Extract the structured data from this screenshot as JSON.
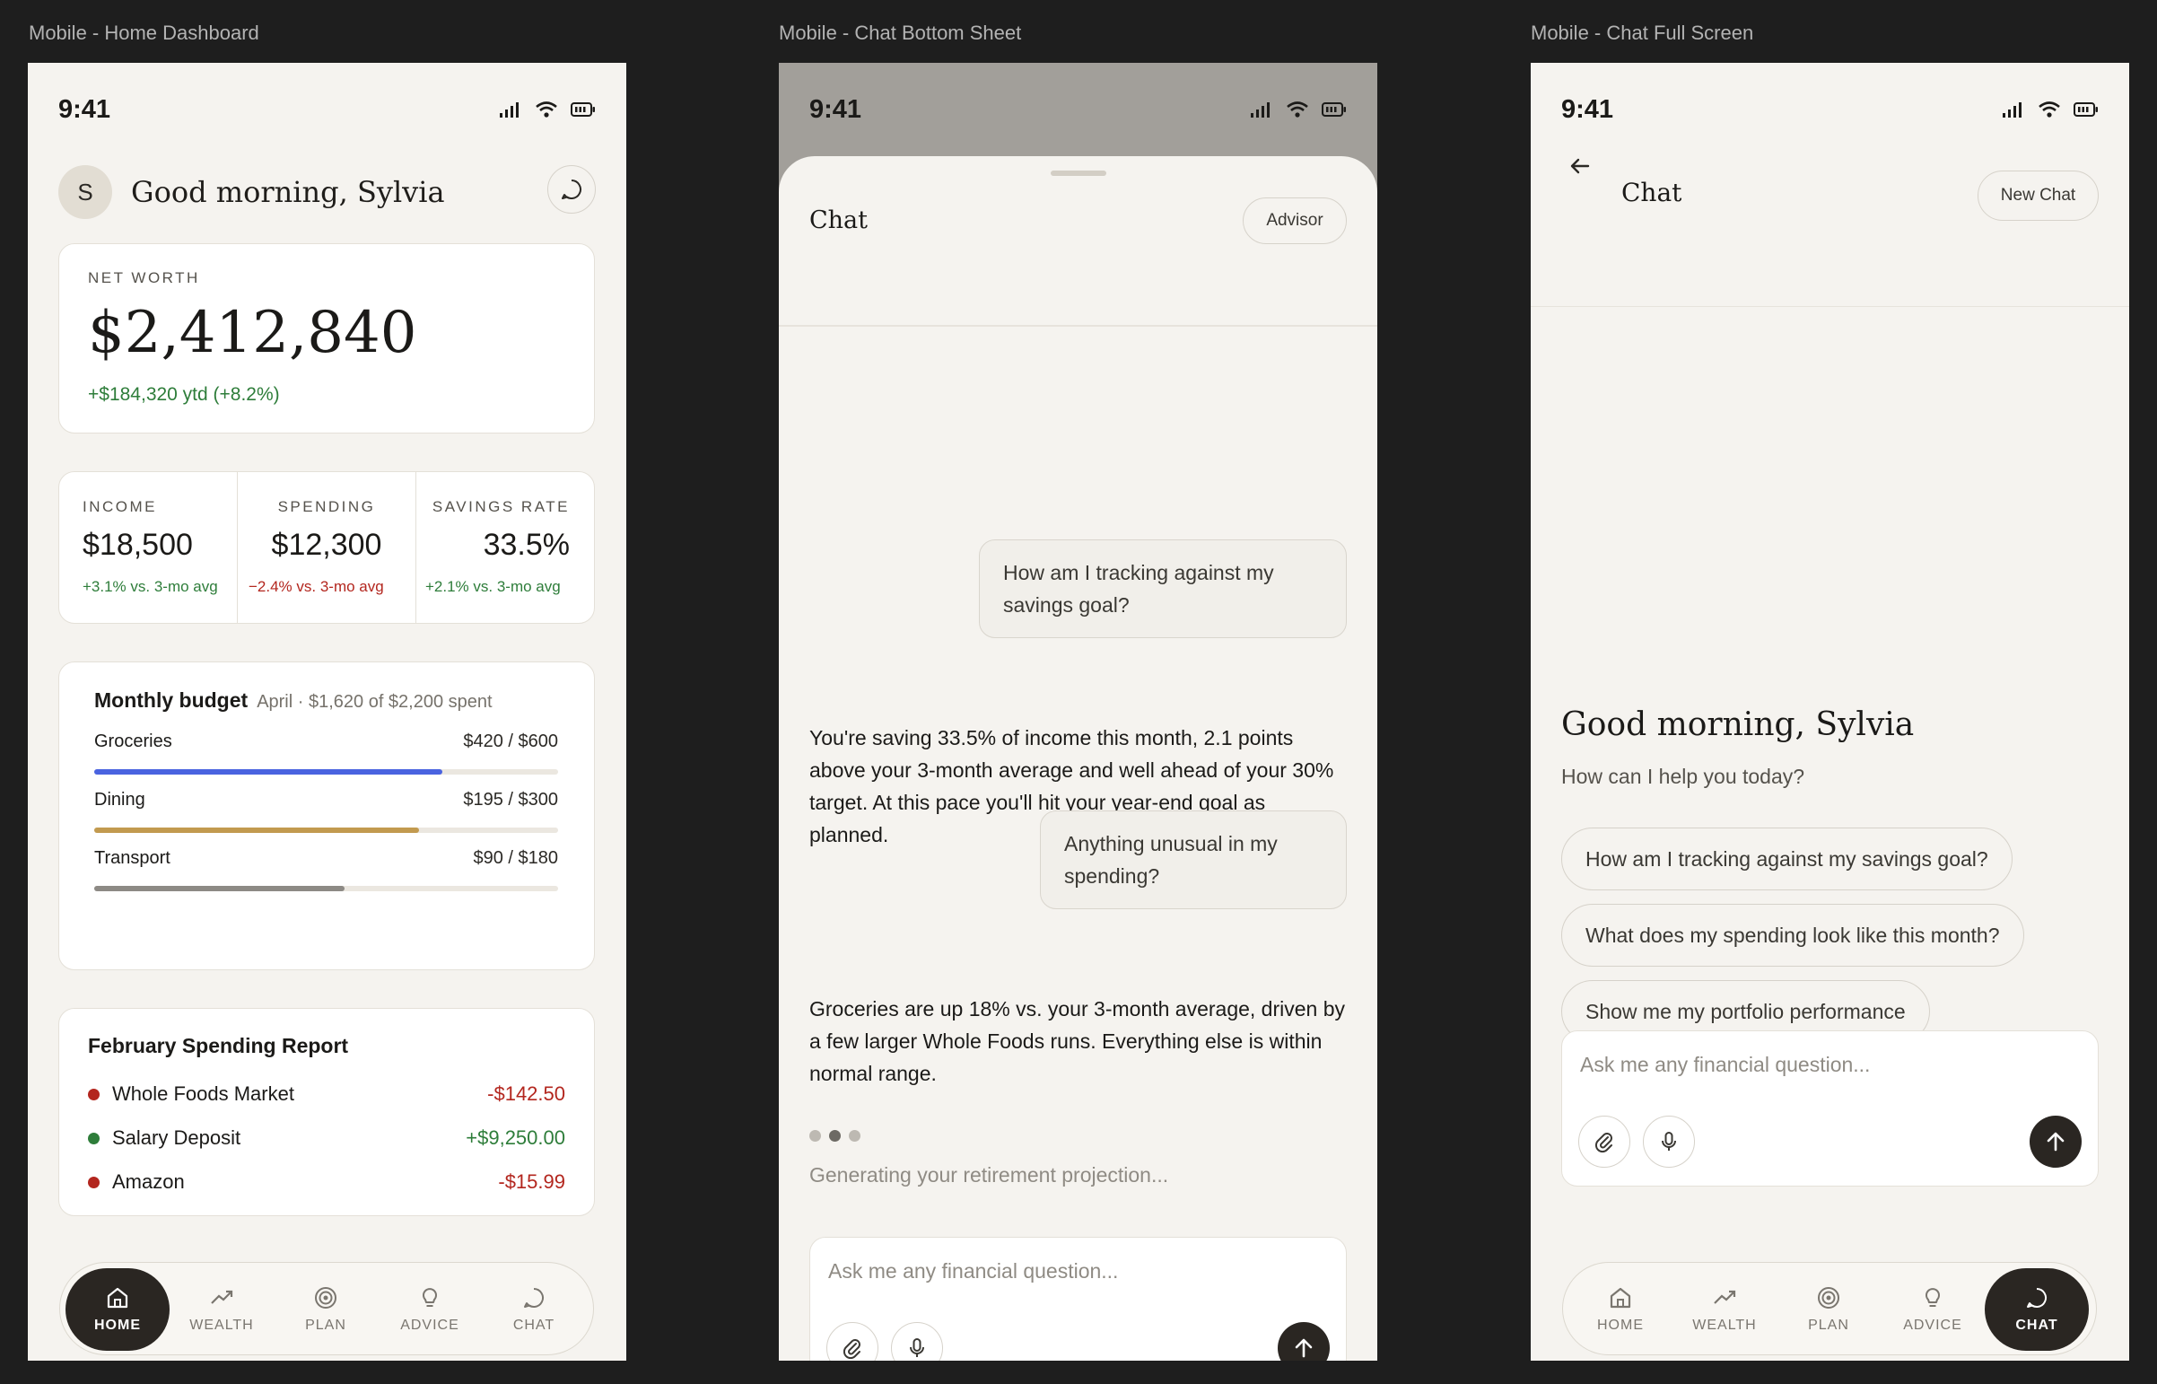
{
  "frames": {
    "home": "Mobile - Home Dashboard",
    "sheet": "Mobile - Chat Bottom Sheet",
    "full": "Mobile - Chat Full Screen"
  },
  "status": {
    "time": "9:41"
  },
  "home": {
    "avatar_initial": "S",
    "greeting": "Good morning, Sylvia",
    "net_worth": {
      "label": "NET WORTH",
      "value": "$2,412,840",
      "change": "+$184,320 ytd (+8.2%)"
    },
    "stats": [
      {
        "label": "INCOME",
        "value": "$18,500",
        "sub": "+3.1% vs. 3-mo avg",
        "tone": "green"
      },
      {
        "label": "SPENDING",
        "value": "$12,300",
        "sub": "−2.4% vs. 3-mo avg",
        "tone": "red"
      },
      {
        "label": "SAVINGS RATE",
        "value": "33.5%",
        "sub": "+2.1% vs. 3-mo avg",
        "tone": "green"
      }
    ],
    "budget": {
      "title": "Monthly budget",
      "subtitle": "April · $1,620 of $2,200 spent",
      "items": [
        {
          "name": "Groceries",
          "amount": "$420 / $600",
          "progress": 0.75,
          "color": "#4a63e0"
        },
        {
          "name": "Dining",
          "amount": "$195 / $300",
          "progress": 0.7,
          "color": "#c29a4f"
        },
        {
          "name": "Transport",
          "amount": "$90 / $180",
          "progress": 0.54,
          "color": "#8d8a85"
        }
      ]
    },
    "report": {
      "title": "February Spending Report",
      "items": [
        {
          "name": "Whole Foods Market",
          "amount": "-$142.50",
          "tone": "red"
        },
        {
          "name": "Salary Deposit",
          "amount": "+$9,250.00",
          "tone": "green"
        },
        {
          "name": "Amazon",
          "amount": "-$15.99",
          "tone": "red"
        }
      ]
    }
  },
  "tabs": [
    "HOME",
    "WEALTH",
    "PLAN",
    "ADVICE",
    "CHAT"
  ],
  "sheet": {
    "title": "Chat",
    "advisor_label": "Advisor",
    "messages": {
      "user1": "How am I tracking against my savings goal?",
      "bot1": "You're saving 33.5% of income this month, 2.1 points above your 3-month average and well ahead of your 30% target. At this pace you'll hit your year-end goal as planned.",
      "user2": "Anything unusual in my spending?",
      "bot2": "Groceries are up 18% vs. your 3-month average, driven by a few larger Whole Foods runs. Everything else is within normal range."
    },
    "generating": "Generating your retirement projection...",
    "input_placeholder": "Ask me any financial question..."
  },
  "full": {
    "title": "Chat",
    "new_chat_label": "New Chat",
    "greeting": "Good morning, Sylvia",
    "subtitle": "How can I help you today?",
    "suggestions": [
      "How am I tracking against my savings goal?",
      "What does my spending look like this month?",
      "Show me my portfolio performance"
    ],
    "input_placeholder": "Ask me any financial question..."
  }
}
